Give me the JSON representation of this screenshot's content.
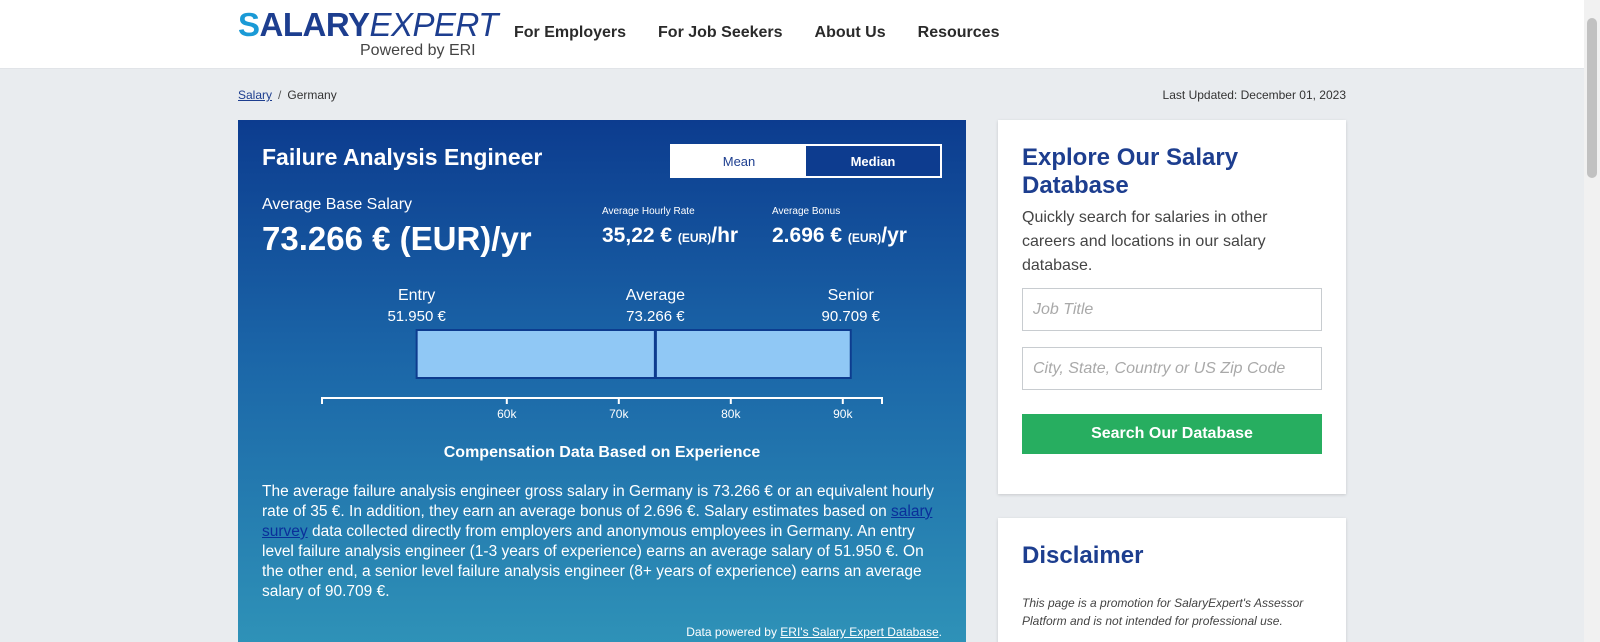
{
  "header": {
    "logo_s": "S",
    "logo_salary": "ALARY",
    "logo_expert": "EXPERT",
    "logo_sub": "Powered by ERI",
    "nav": [
      "For Employers",
      "For Job Seekers",
      "About Us",
      "Resources"
    ]
  },
  "breadcrumb": {
    "root": "Salary",
    "sep": "/",
    "current": "Germany"
  },
  "last_updated": "Last Updated: December 01, 2023",
  "main": {
    "title": "Failure Analysis Engineer",
    "toggle": {
      "mean": "Mean",
      "median": "Median",
      "active": "median"
    },
    "base_label": "Average Base Salary",
    "base_value": "73.266 € (EUR)/yr",
    "hourly_label": "Average Hourly Rate",
    "hourly_value": "35,22 €",
    "hourly_cur": "(EUR)",
    "hourly_unit": "/hr",
    "bonus_label": "Average Bonus",
    "bonus_value": "2.696 €",
    "bonus_cur": "(EUR)",
    "bonus_unit": "/yr",
    "caption": "Compensation Data Based on Experience",
    "desc_part1": "The average failure analysis engineer gross salary in Germany is 73.266 € or an equivalent hourly rate of 35 €. In addition, they earn an average bonus of 2.696 €. Salary estimates based on ",
    "desc_link": "salary survey",
    "desc_part2": " data collected directly from employers and anonymous employees in Germany. An entry level failure analysis engineer (1-3 years of experience) earns an average salary of 51.950 €. On the other end, a senior level failure analysis engineer (8+ years of experience) earns an average salary of 90.709 €.",
    "powered_prefix": "Data powered by ",
    "powered_link": "ERI's Salary Expert Database",
    "powered_suffix": "."
  },
  "chart_data": {
    "type": "bar",
    "markers": [
      {
        "name": "Entry",
        "value": 51950,
        "label": "51.950 €"
      },
      {
        "name": "Average",
        "value": 73266,
        "label": "73.266 €"
      },
      {
        "name": "Senior",
        "value": 90709,
        "label": "90.709 €"
      }
    ],
    "xlim": [
      43500,
      93500
    ],
    "ticks": [
      {
        "value": 60000,
        "label": "60k"
      },
      {
        "value": 70000,
        "label": "70k"
      },
      {
        "value": 80000,
        "label": "80k"
      },
      {
        "value": 90000,
        "label": "90k"
      }
    ],
    "bar_color": "#90c8f5"
  },
  "explore": {
    "title": "Explore Our Salary Database",
    "desc": "Quickly search for salaries in other careers and locations in our salary database.",
    "job_placeholder": "Job Title",
    "loc_placeholder": "City, State, Country or US Zip Code",
    "button": "Search Our Database"
  },
  "disclaimer": {
    "title": "Disclaimer",
    "text": "This page is a promotion for SalaryExpert's Assessor Platform and is not intended for professional use."
  }
}
